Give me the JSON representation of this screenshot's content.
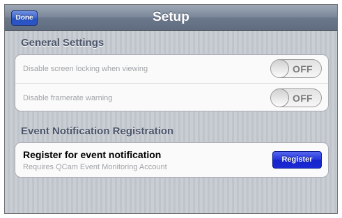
{
  "navbar": {
    "title": "Setup",
    "done_label": "Done",
    "done_color": "#3e64cc"
  },
  "general_settings": {
    "header": "General Settings",
    "rows": [
      {
        "label": "Disable screen locking when viewing",
        "switch_state": "OFF"
      },
      {
        "label": "Disable framerate warning",
        "switch_state": "OFF"
      }
    ]
  },
  "event_notification": {
    "header": "Event Notification Registration",
    "title": "Register for event notification",
    "subtitle": "Requires QCam Event Monitoring Account",
    "register_label": "Register",
    "register_color": "#2233da"
  }
}
